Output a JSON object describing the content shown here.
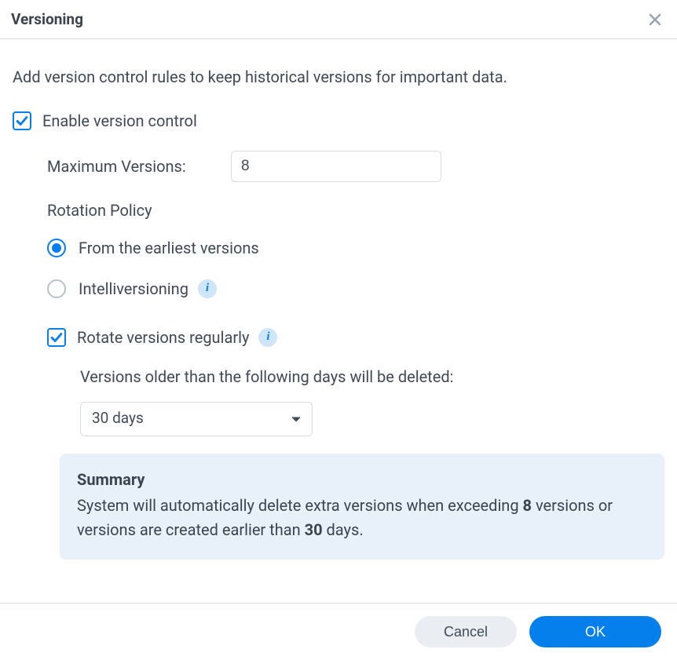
{
  "header": {
    "title": "Versioning"
  },
  "intro": "Add version control rules to keep historical versions for important data.",
  "enable": {
    "label": "Enable version control",
    "checked": true
  },
  "maxVersions": {
    "label": "Maximum Versions:",
    "value": "8"
  },
  "rotationPolicy": {
    "sectionLabel": "Rotation Policy",
    "options": {
      "earliest": {
        "label": "From the earliest versions",
        "selected": true
      },
      "intelli": {
        "label": "Intelliversioning",
        "selected": false
      }
    }
  },
  "rotateRegularly": {
    "label": "Rotate versions regularly",
    "checked": true,
    "helper": "Versions older than the following days will be deleted:",
    "selected": "30 days"
  },
  "summary": {
    "title": "Summary",
    "text_pre": "System will automatically delete extra versions when exceeding ",
    "bold1": "8",
    "text_mid": " versions or versions are created earlier than ",
    "bold2": "30",
    "text_post": " days."
  },
  "footer": {
    "cancel": "Cancel",
    "ok": "OK"
  },
  "info_glyph": "i"
}
